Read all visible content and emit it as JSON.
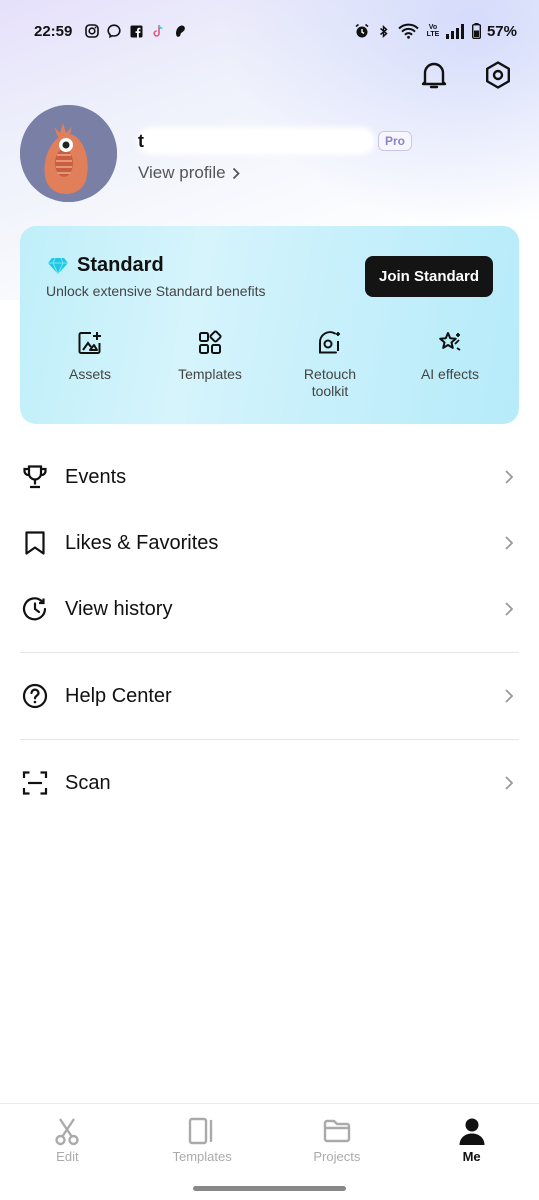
{
  "status_bar": {
    "time": "22:59",
    "left_icons": [
      "instagram-icon",
      "messenger-icon",
      "facebook-icon",
      "tiktok-icon",
      "app-icon"
    ],
    "right_icons": [
      "alarm-icon",
      "bluetooth-icon",
      "wifi-icon",
      "volte-icon",
      "signal-icon",
      "battery-icon"
    ],
    "volte_text": "Vo LTE",
    "battery": "57%"
  },
  "header": {
    "notification_icon": "bell-icon",
    "settings_icon": "settings-icon"
  },
  "profile": {
    "name_visible": "t",
    "pro_badge": "Pro",
    "view_profile": "View profile"
  },
  "standard_card": {
    "title": "Standard",
    "subtitle": "Unlock extensive Standard benefits",
    "join_button": "Join Standard",
    "features": [
      {
        "label": "Assets",
        "icon": "assets-icon"
      },
      {
        "label": "Templates",
        "icon": "templates-grid-icon"
      },
      {
        "label": "Retouch toolkit",
        "icon": "retouch-icon"
      },
      {
        "label": "AI effects",
        "icon": "ai-effects-icon"
      }
    ]
  },
  "menu": {
    "items": [
      {
        "label": "Events",
        "icon": "trophy-icon"
      },
      {
        "label": "Likes & Favorites",
        "icon": "bookmark-icon"
      },
      {
        "label": "View history",
        "icon": "history-icon"
      },
      {
        "label": "Help Center",
        "icon": "help-icon"
      },
      {
        "label": "Scan",
        "icon": "scan-icon"
      }
    ]
  },
  "bottom_nav": {
    "items": [
      {
        "label": "Edit",
        "icon": "scissors-icon",
        "active": false
      },
      {
        "label": "Templates",
        "icon": "templates-icon",
        "active": false
      },
      {
        "label": "Projects",
        "icon": "folder-icon",
        "active": false
      },
      {
        "label": "Me",
        "icon": "person-icon",
        "active": true
      }
    ]
  },
  "colors": {
    "accent_dark": "#141414",
    "diamond": "#1fc7e6",
    "card_bg": "#c8f0fb"
  }
}
